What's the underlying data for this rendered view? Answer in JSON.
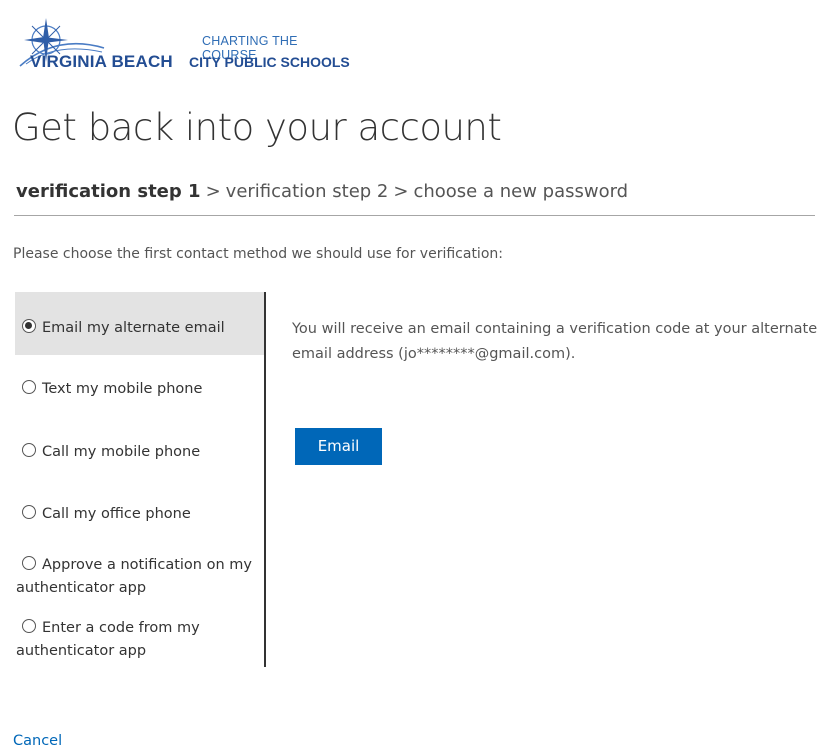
{
  "logo": {
    "tagline": "CHARTING THE COURSE",
    "name_left": "VIRGINIA BEACH",
    "name_right": "CITY PUBLIC SCHOOLS",
    "icon": "compass-rose-icon"
  },
  "page": {
    "title": "Get back into your account"
  },
  "steps": {
    "step1": "verification step 1",
    "separator": ">",
    "step2": "verification step 2",
    "step3": "choose a new password"
  },
  "instruction": "Please choose the first contact method we should use for verification:",
  "methods": [
    {
      "label": "Email my alternate email",
      "selected": true
    },
    {
      "label": "Text my mobile phone",
      "selected": false
    },
    {
      "label": "Call my mobile phone",
      "selected": false
    },
    {
      "label": "Call my office phone",
      "selected": false
    },
    {
      "label_line1": "Approve a notification on my",
      "label_line2": "authenticator app",
      "selected": false
    },
    {
      "label_line1": "Enter a code from my",
      "label_line2": "authenticator app",
      "selected": false
    }
  ],
  "detail": {
    "description": "You will receive an email containing a verification code at your alternate email address (jo********@gmail.com).",
    "button_label": "Email"
  },
  "footer": {
    "cancel_label": "Cancel"
  },
  "colors": {
    "accent": "#0067b8",
    "logo_blue": "#234d93",
    "selected_bg": "#e3e3e3"
  }
}
